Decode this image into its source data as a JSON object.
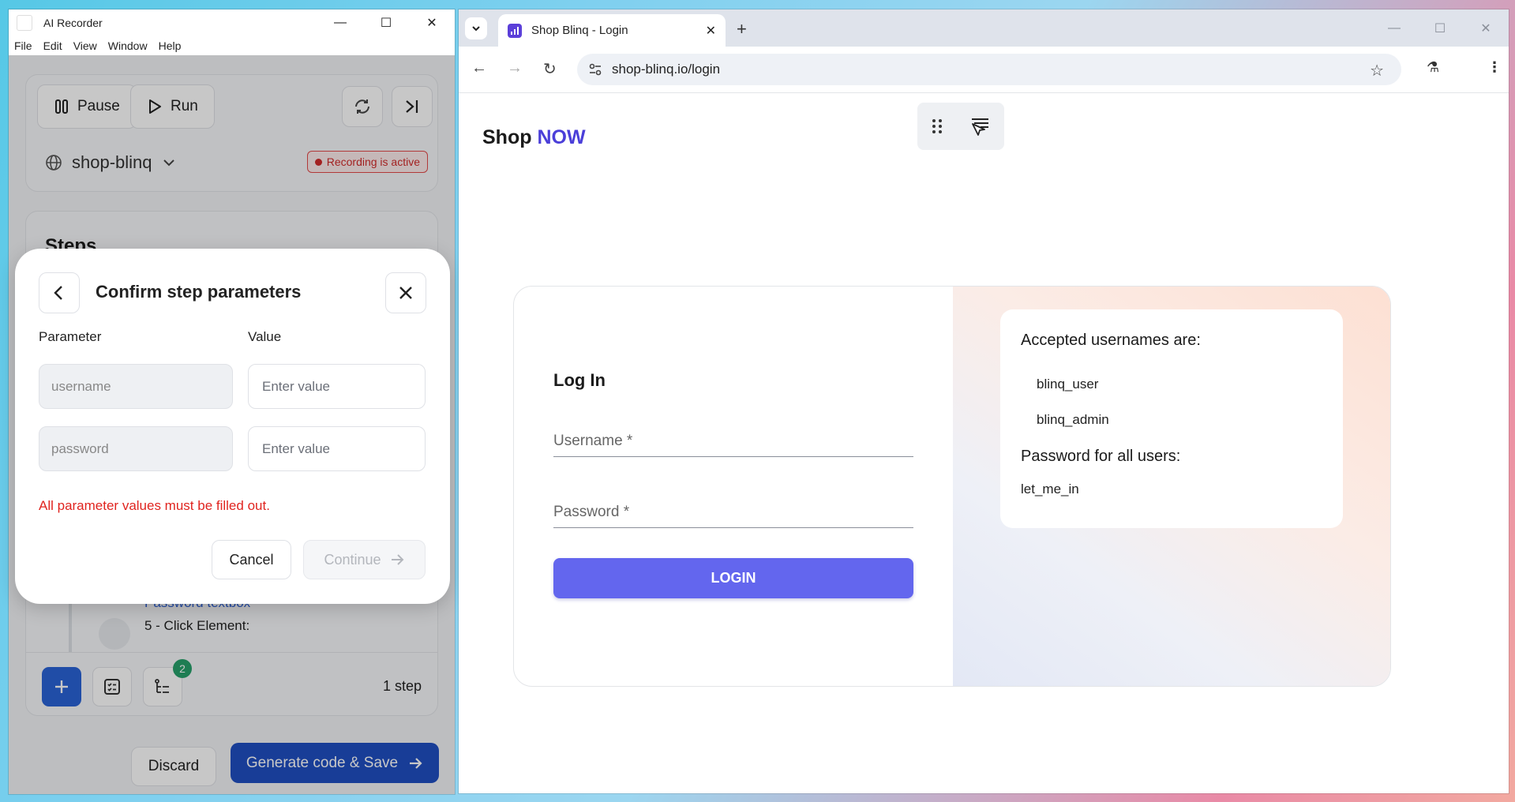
{
  "recorder": {
    "window_title": "AI Recorder",
    "menu": [
      "File",
      "Edit",
      "View",
      "Window",
      "Help"
    ],
    "pause_label": "Pause",
    "run_label": "Run",
    "project_name": "shop-blinq",
    "recording_status": "Recording is active",
    "steps_title": "Steps",
    "step_link": "Password textbox",
    "step_text": "5 - Click Element:",
    "badge_count": "2",
    "step_count": "1 step",
    "discard_label": "Discard",
    "generate_label": "Generate code & Save"
  },
  "modal": {
    "title": "Confirm step parameters",
    "parameter_header": "Parameter",
    "value_header": "Value",
    "params": [
      {
        "name": "username",
        "placeholder": "Enter value"
      },
      {
        "name": "password",
        "placeholder": "Enter value"
      }
    ],
    "error": "All parameter values must be filled out.",
    "cancel_label": "Cancel",
    "continue_label": "Continue"
  },
  "browser": {
    "tab_title": "Shop Blinq - Login",
    "url": "shop-blinq.io/login",
    "brand_prefix": "Shop",
    "brand_accent": "NOW",
    "login_heading": "Log In",
    "username_label": "Username *",
    "password_label": "Password *",
    "login_button": "LOGIN",
    "accepted_heading": "Accepted usernames are:",
    "usernames": [
      "blinq_user",
      "blinq_admin"
    ],
    "password_heading": "Password for all users:",
    "password_value": "let_me_in"
  },
  "colors": {
    "accent_blue": "#1f4fc2",
    "brand_purple": "#4b3fd9",
    "login_button": "#6366ee",
    "error_red": "#e0241f"
  }
}
